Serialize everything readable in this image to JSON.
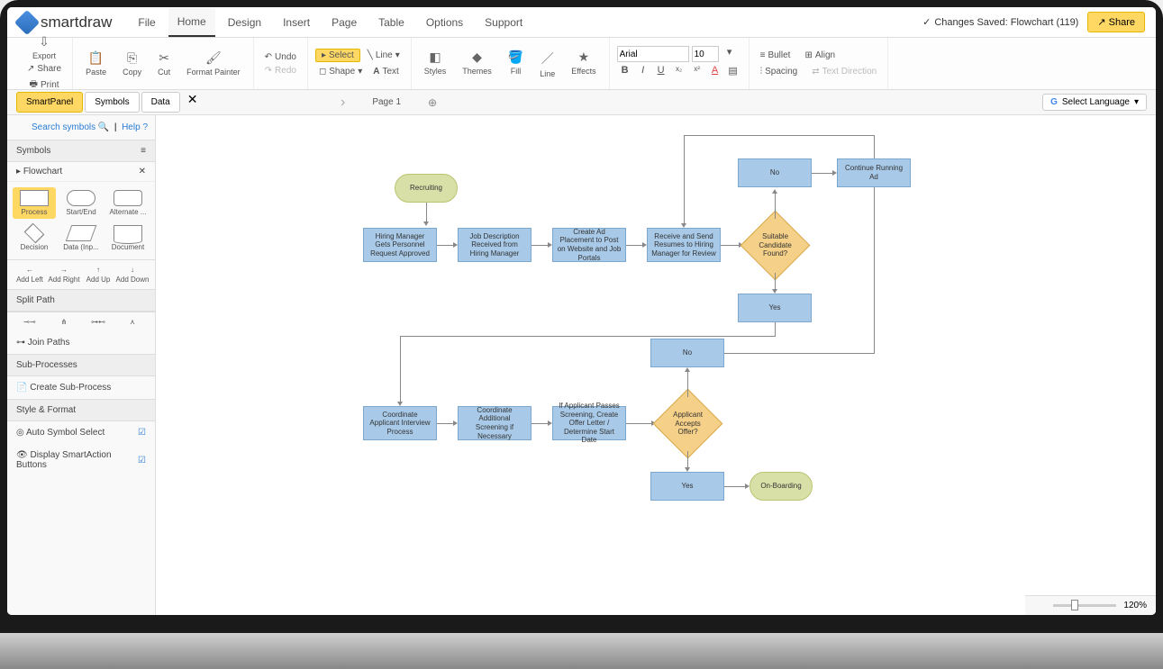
{
  "app": {
    "name": "smartdraw"
  },
  "menu": {
    "items": [
      "File",
      "Home",
      "Design",
      "Insert",
      "Page",
      "Table",
      "Options",
      "Support"
    ],
    "active": "Home"
  },
  "status": {
    "saved": "Changes Saved: Flowchart (119)",
    "share": "Share"
  },
  "ribbon": {
    "export": "Export",
    "print": "Print",
    "share": "Share",
    "paste": "Paste",
    "copy": "Copy",
    "cut": "Cut",
    "format_painter": "Format Painter",
    "undo": "Undo",
    "redo": "Redo",
    "select": "Select",
    "shape": "Shape",
    "line": "Line",
    "text": "Text",
    "styles": "Styles",
    "themes": "Themes",
    "fill": "Fill",
    "line_tool": "Line",
    "effects": "Effects",
    "font": "Arial",
    "size": "10",
    "bullet": "Bullet",
    "align": "Align",
    "spacing": "Spacing",
    "text_direction": "Text Direction"
  },
  "panels": {
    "tabs": [
      "SmartPanel",
      "Symbols",
      "Data"
    ],
    "active": "SmartPanel"
  },
  "pagetab": {
    "page1": "Page 1"
  },
  "lang": "Select Language",
  "sidebar": {
    "search": "Search symbols",
    "help": "Help",
    "symbols_header": "Symbols",
    "flowchart_header": "Flowchart",
    "symbols": [
      "Process",
      "Start/End",
      "Alternate ...",
      "Decision",
      "Data (Inp...",
      "Document"
    ],
    "actions": [
      "Add Left",
      "Add Right",
      "Add Up",
      "Add Down"
    ],
    "split_path": "Split Path",
    "join_paths": "Join Paths",
    "sub_processes": "Sub-Processes",
    "create_sub": "Create Sub-Process",
    "style_format": "Style & Format",
    "auto_symbol": "Auto Symbol Select",
    "display_smart": "Display SmartAction Buttons"
  },
  "flowchart": {
    "recruiting": "Recruiting",
    "n1": "Hiring Manager Gets Personnel Request Approved",
    "n2": "Job Description Received from Hiring Manager",
    "n3": "Create Ad Placement to Post on Website and Job Portals",
    "n4": "Receive and Send Resumes to Hiring Manager for Review",
    "d1": "Suitable Candidate Found?",
    "no1": "No",
    "cont": "Continue Running Ad",
    "yes1": "Yes",
    "n5": "Coordinate Applicant Interview Process",
    "n6": "Coordinate Additional Screening if Necessary",
    "n7": "If Applicant Passes Screening, Create Offer Letter / Determine Start Date",
    "d2": "Applicant Accepts Offer?",
    "no2": "No",
    "yes2": "Yes",
    "onboard": "On-Boarding"
  },
  "zoom": "120%"
}
